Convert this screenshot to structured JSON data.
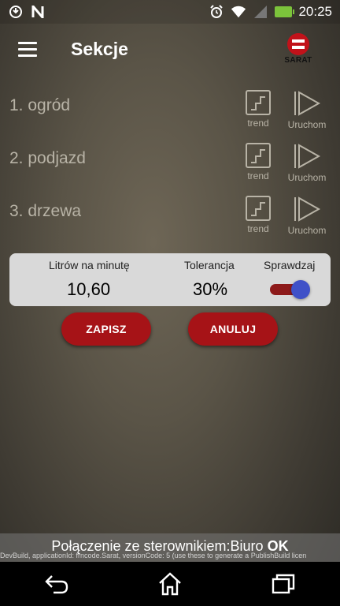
{
  "statusbar": {
    "left_icons": [
      "sync-icon",
      "n-notification-icon"
    ],
    "right_icons": [
      "alarm-icon",
      "wifi-icon",
      "signal-icon",
      "battery-charging-icon"
    ],
    "time": "20:25"
  },
  "header": {
    "title": "Sekcje",
    "logo_text": "SARAT",
    "brand_color": "#c1121a"
  },
  "sections": [
    {
      "name": "1. ogród",
      "trend_label": "trend",
      "run_label": "Uruchom"
    },
    {
      "name": "2. podjazd",
      "trend_label": "trend",
      "run_label": "Uruchom"
    },
    {
      "name": "3. drzewa",
      "trend_label": "trend",
      "run_label": "Uruchom"
    }
  ],
  "panel": {
    "flow_label": "Litrów na minutę",
    "flow_value": "10,60",
    "tolerance_label": "Tolerancja",
    "tolerance_value": "30%",
    "check_label": "Sprawdzaj",
    "check_enabled": true
  },
  "buttons": {
    "save": "ZAPISZ",
    "cancel": "ANULUJ",
    "color": "#a61317"
  },
  "connection": {
    "text": "Połączenie ze sterownikiem:Biuro",
    "status": "OK",
    "devbuild": "DevBuild, applicationId: frncode.Sarat, versionCode: 5 (use these to generate a PublishBuild licen"
  },
  "navbar": {
    "icons": [
      "back-icon",
      "home-icon",
      "recents-icon"
    ]
  }
}
